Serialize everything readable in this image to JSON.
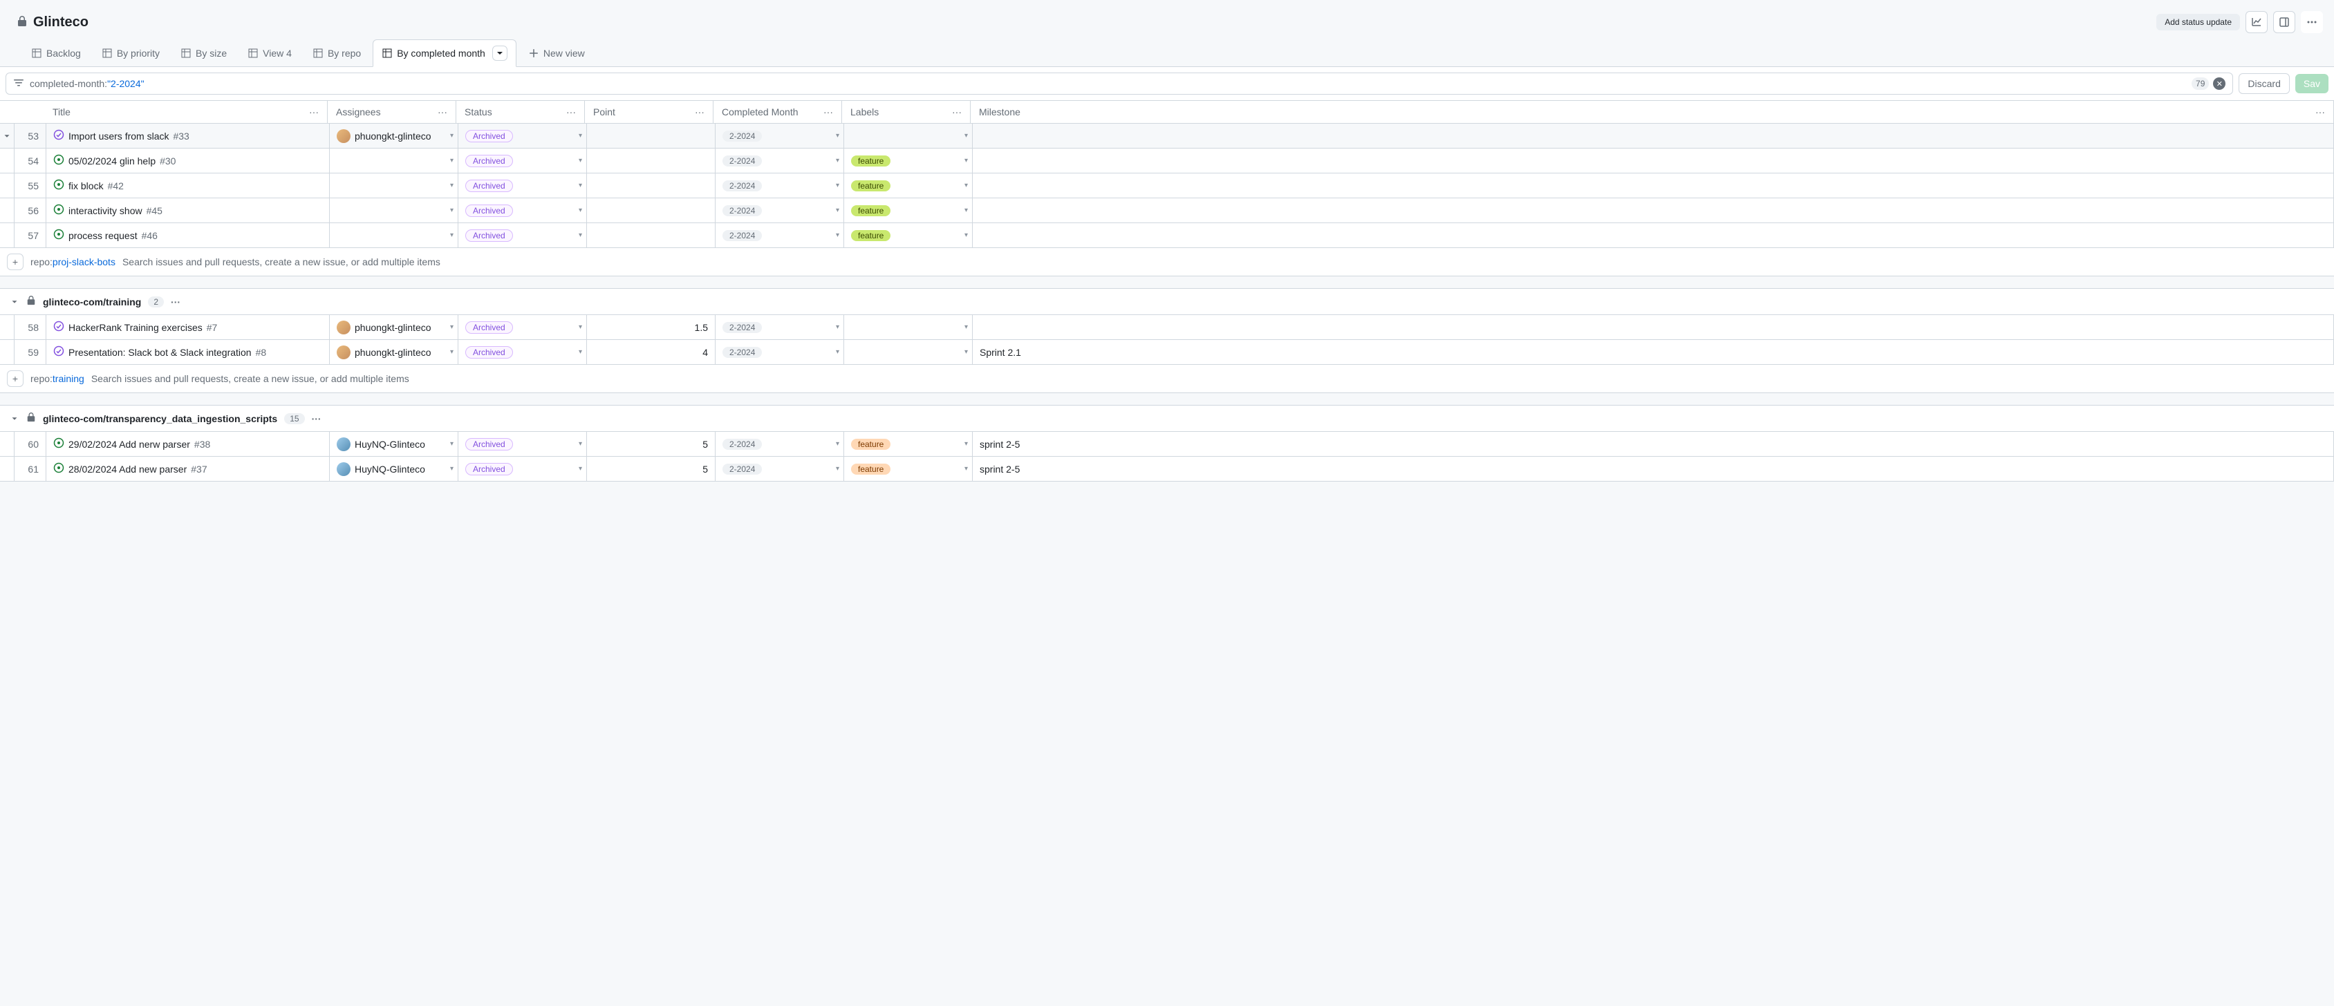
{
  "project": {
    "title": "Glinteco"
  },
  "header_actions": {
    "add_status_update": "Add status update"
  },
  "tabs": [
    {
      "label": "Backlog"
    },
    {
      "label": "By priority"
    },
    {
      "label": "By size"
    },
    {
      "label": "View 4"
    },
    {
      "label": "By repo"
    },
    {
      "label": "By completed month",
      "active": true
    },
    {
      "label": "New view",
      "new": true
    }
  ],
  "filter": {
    "key": "completed-month:",
    "value": "\"2-2024\"",
    "count": "79",
    "discard": "Discard",
    "save": "Sav"
  },
  "columns": {
    "title": "Title",
    "assignees": "Assignees",
    "status": "Status",
    "point": "Point",
    "month": "Completed Month",
    "labels": "Labels",
    "milestone": "Milestone"
  },
  "groups": [
    {
      "add_repo_prefix": "repo:",
      "add_repo": "proj-slack-bots",
      "add_placeholder": "Search issues and pull requests, create a new issue, or add multiple items",
      "rows": [
        {
          "n": "53",
          "state": "closed",
          "title": "Import users from slack",
          "issue": "#33",
          "assignee": "phuongkt-glinteco",
          "avatar": "tan",
          "status": "Archived",
          "month": "2-2024",
          "selected": true
        },
        {
          "n": "54",
          "state": "open",
          "title": "05/02/2024 glin help",
          "issue": "#30",
          "status": "Archived",
          "month": "2-2024",
          "label": "feature",
          "label_color": "green"
        },
        {
          "n": "55",
          "state": "open",
          "title": "fix block",
          "issue": "#42",
          "status": "Archived",
          "month": "2-2024",
          "label": "feature",
          "label_color": "green"
        },
        {
          "n": "56",
          "state": "open",
          "title": "interactivity show",
          "issue": "#45",
          "status": "Archived",
          "month": "2-2024",
          "label": "feature",
          "label_color": "green"
        },
        {
          "n": "57",
          "state": "open",
          "title": "process request",
          "issue": "#46",
          "status": "Archived",
          "month": "2-2024",
          "label": "feature",
          "label_color": "green"
        }
      ]
    },
    {
      "name": "glinteco-com/training",
      "count": "2",
      "add_repo_prefix": "repo:",
      "add_repo": "training",
      "add_placeholder": "Search issues and pull requests, create a new issue, or add multiple items",
      "rows": [
        {
          "n": "58",
          "state": "closed",
          "title": "HackerRank Training exercises",
          "issue": "#7",
          "assignee": "phuongkt-glinteco",
          "avatar": "tan",
          "status": "Archived",
          "point": "1.5",
          "month": "2-2024"
        },
        {
          "n": "59",
          "state": "closed",
          "title": "Presentation: Slack bot & Slack integration",
          "issue": "#8",
          "assignee": "phuongkt-glinteco",
          "avatar": "tan",
          "status": "Archived",
          "point": "4",
          "month": "2-2024",
          "milestone": "Sprint 2.1"
        }
      ]
    },
    {
      "name": "glinteco-com/transparency_data_ingestion_scripts",
      "count": "15",
      "rows": [
        {
          "n": "60",
          "state": "open",
          "title": "29/02/2024 Add nerw parser",
          "issue": "#38",
          "assignee": "HuyNQ-Glinteco",
          "avatar": "blue",
          "status": "Archived",
          "point": "5",
          "month": "2-2024",
          "label": "feature",
          "label_color": "orange",
          "milestone": "sprint 2-5"
        },
        {
          "n": "61",
          "state": "open",
          "title": "28/02/2024 Add new parser",
          "issue": "#37",
          "assignee": "HuyNQ-Glinteco",
          "avatar": "blue",
          "status": "Archived",
          "point": "5",
          "month": "2-2024",
          "label": "feature",
          "label_color": "orange",
          "milestone": "sprint 2-5"
        }
      ]
    }
  ]
}
